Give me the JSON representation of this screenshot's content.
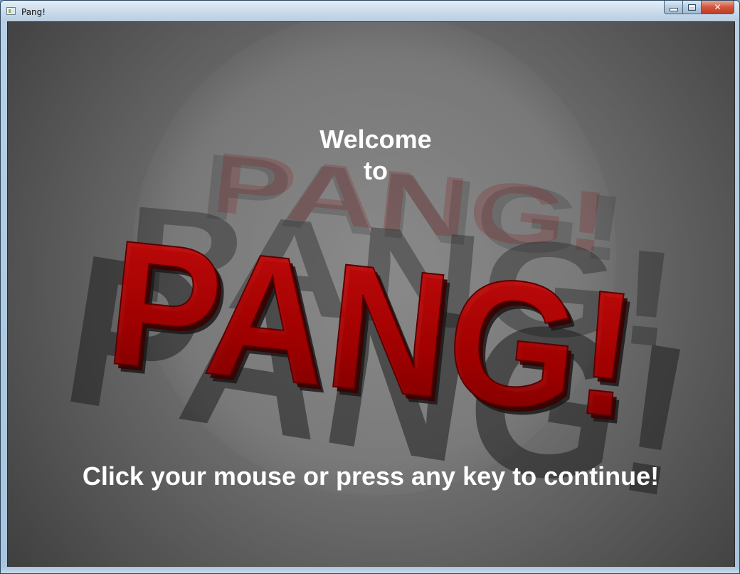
{
  "window": {
    "title": "Pang!",
    "icon": "app-window-icon",
    "controls": {
      "minimize_icon": "minimize-icon",
      "maximize_icon": "maximize-icon",
      "close_icon": "close-icon",
      "close_glyph": "✕"
    }
  },
  "game": {
    "welcome_line1": "Welcome",
    "welcome_line2": "to",
    "logo_text": "PANG!",
    "prompt": "Click your mouse or press any key to continue!"
  },
  "colors": {
    "logo_red": "#b00000",
    "background_gray": "#6d6d6d",
    "text": "#ffffff"
  }
}
